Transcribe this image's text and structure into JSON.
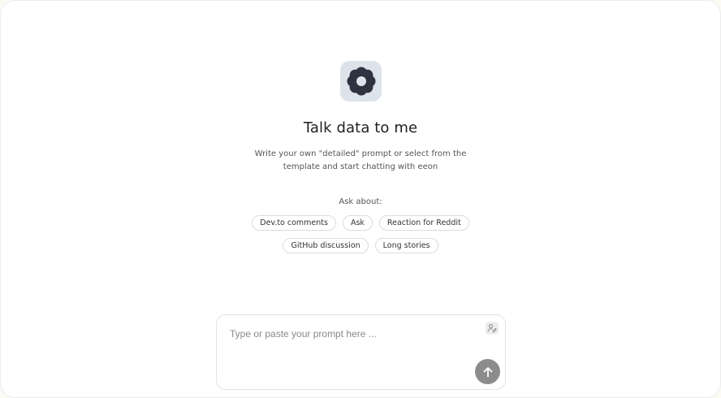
{
  "hero": {
    "logo_icon": "flower-icon",
    "title": "Talk data to me",
    "subtitle_line1": "Write your own \"detailed\" prompt or select from the",
    "subtitle_line2": "template and start chatting with eeon"
  },
  "suggestions": {
    "label": "Ask about:",
    "row1": [
      "Dev.to comments",
      "Ask",
      "Reaction for Reddit"
    ],
    "row2": [
      "GitHub discussion",
      "Long stories"
    ]
  },
  "prompt": {
    "placeholder": "Type or paste your prompt here ...",
    "value": "",
    "persona_icon": "user-edit-icon",
    "send_icon": "arrow-up-icon"
  },
  "colors": {
    "logo_bg": "#dde3ea",
    "logo_fg": "#2d3340",
    "send_bg": "#8c8c8c"
  }
}
